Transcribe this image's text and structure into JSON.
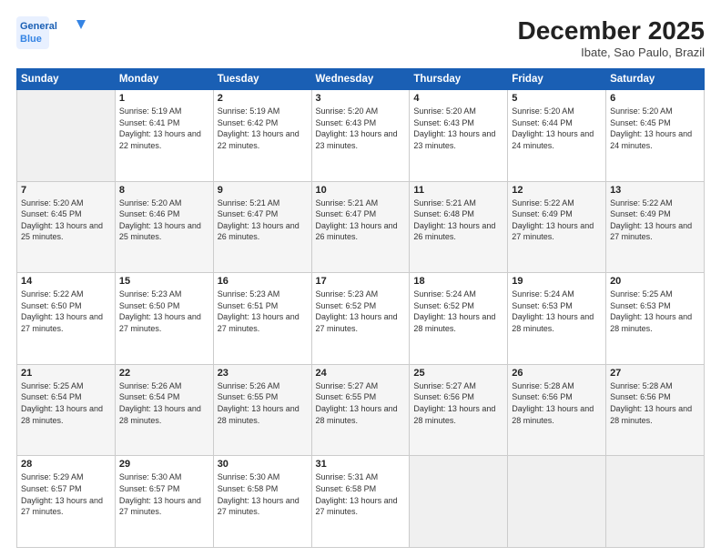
{
  "header": {
    "logo_line1": "General",
    "logo_line2": "Blue",
    "month": "December 2025",
    "location": "Ibate, Sao Paulo, Brazil"
  },
  "days_of_week": [
    "Sunday",
    "Monday",
    "Tuesday",
    "Wednesday",
    "Thursday",
    "Friday",
    "Saturday"
  ],
  "weeks": [
    [
      {
        "day": "",
        "empty": true
      },
      {
        "day": "1",
        "sunrise": "5:19 AM",
        "sunset": "6:41 PM",
        "daylight": "13 hours and 22 minutes."
      },
      {
        "day": "2",
        "sunrise": "5:19 AM",
        "sunset": "6:42 PM",
        "daylight": "13 hours and 22 minutes."
      },
      {
        "day": "3",
        "sunrise": "5:20 AM",
        "sunset": "6:43 PM",
        "daylight": "13 hours and 23 minutes."
      },
      {
        "day": "4",
        "sunrise": "5:20 AM",
        "sunset": "6:43 PM",
        "daylight": "13 hours and 23 minutes."
      },
      {
        "day": "5",
        "sunrise": "5:20 AM",
        "sunset": "6:44 PM",
        "daylight": "13 hours and 24 minutes."
      },
      {
        "day": "6",
        "sunrise": "5:20 AM",
        "sunset": "6:45 PM",
        "daylight": "13 hours and 24 minutes."
      }
    ],
    [
      {
        "day": "7",
        "sunrise": "5:20 AM",
        "sunset": "6:45 PM",
        "daylight": "13 hours and 25 minutes."
      },
      {
        "day": "8",
        "sunrise": "5:20 AM",
        "sunset": "6:46 PM",
        "daylight": "13 hours and 25 minutes."
      },
      {
        "day": "9",
        "sunrise": "5:21 AM",
        "sunset": "6:47 PM",
        "daylight": "13 hours and 26 minutes."
      },
      {
        "day": "10",
        "sunrise": "5:21 AM",
        "sunset": "6:47 PM",
        "daylight": "13 hours and 26 minutes."
      },
      {
        "day": "11",
        "sunrise": "5:21 AM",
        "sunset": "6:48 PM",
        "daylight": "13 hours and 26 minutes."
      },
      {
        "day": "12",
        "sunrise": "5:22 AM",
        "sunset": "6:49 PM",
        "daylight": "13 hours and 27 minutes."
      },
      {
        "day": "13",
        "sunrise": "5:22 AM",
        "sunset": "6:49 PM",
        "daylight": "13 hours and 27 minutes."
      }
    ],
    [
      {
        "day": "14",
        "sunrise": "5:22 AM",
        "sunset": "6:50 PM",
        "daylight": "13 hours and 27 minutes."
      },
      {
        "day": "15",
        "sunrise": "5:23 AM",
        "sunset": "6:50 PM",
        "daylight": "13 hours and 27 minutes."
      },
      {
        "day": "16",
        "sunrise": "5:23 AM",
        "sunset": "6:51 PM",
        "daylight": "13 hours and 27 minutes."
      },
      {
        "day": "17",
        "sunrise": "5:23 AM",
        "sunset": "6:52 PM",
        "daylight": "13 hours and 27 minutes."
      },
      {
        "day": "18",
        "sunrise": "5:24 AM",
        "sunset": "6:52 PM",
        "daylight": "13 hours and 28 minutes."
      },
      {
        "day": "19",
        "sunrise": "5:24 AM",
        "sunset": "6:53 PM",
        "daylight": "13 hours and 28 minutes."
      },
      {
        "day": "20",
        "sunrise": "5:25 AM",
        "sunset": "6:53 PM",
        "daylight": "13 hours and 28 minutes."
      }
    ],
    [
      {
        "day": "21",
        "sunrise": "5:25 AM",
        "sunset": "6:54 PM",
        "daylight": "13 hours and 28 minutes."
      },
      {
        "day": "22",
        "sunrise": "5:26 AM",
        "sunset": "6:54 PM",
        "daylight": "13 hours and 28 minutes."
      },
      {
        "day": "23",
        "sunrise": "5:26 AM",
        "sunset": "6:55 PM",
        "daylight": "13 hours and 28 minutes."
      },
      {
        "day": "24",
        "sunrise": "5:27 AM",
        "sunset": "6:55 PM",
        "daylight": "13 hours and 28 minutes."
      },
      {
        "day": "25",
        "sunrise": "5:27 AM",
        "sunset": "6:56 PM",
        "daylight": "13 hours and 28 minutes."
      },
      {
        "day": "26",
        "sunrise": "5:28 AM",
        "sunset": "6:56 PM",
        "daylight": "13 hours and 28 minutes."
      },
      {
        "day": "27",
        "sunrise": "5:28 AM",
        "sunset": "6:56 PM",
        "daylight": "13 hours and 28 minutes."
      }
    ],
    [
      {
        "day": "28",
        "sunrise": "5:29 AM",
        "sunset": "6:57 PM",
        "daylight": "13 hours and 27 minutes."
      },
      {
        "day": "29",
        "sunrise": "5:30 AM",
        "sunset": "6:57 PM",
        "daylight": "13 hours and 27 minutes."
      },
      {
        "day": "30",
        "sunrise": "5:30 AM",
        "sunset": "6:58 PM",
        "daylight": "13 hours and 27 minutes."
      },
      {
        "day": "31",
        "sunrise": "5:31 AM",
        "sunset": "6:58 PM",
        "daylight": "13 hours and 27 minutes."
      },
      {
        "day": "",
        "empty": true
      },
      {
        "day": "",
        "empty": true
      },
      {
        "day": "",
        "empty": true
      }
    ]
  ],
  "labels": {
    "sunrise": "Sunrise:",
    "sunset": "Sunset:",
    "daylight": "Daylight:"
  }
}
